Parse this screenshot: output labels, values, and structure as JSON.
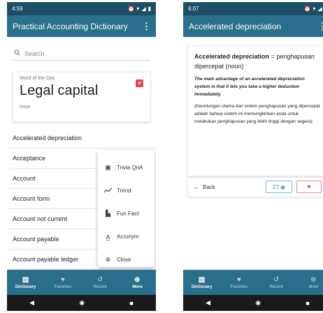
{
  "left": {
    "status": {
      "time": "4:59",
      "icons": [
        "notification-icon",
        "alarm-icon",
        "wifi-icon",
        "signal-icon",
        "battery-icon"
      ]
    },
    "appbar": {
      "title": "Practical Accounting Dictionary"
    },
    "search": {
      "placeholder": "Search"
    },
    "word_of_day": {
      "caption": "Word of the Day",
      "term": "Legal capital",
      "part_of_speech": "noun"
    },
    "words": [
      "Accelerated depreciation",
      "Acceptance",
      "Account",
      "Account form",
      "Account not current",
      "Account payable",
      "Account payable ledger"
    ],
    "more_menu": [
      {
        "label": "Trivia QnA",
        "icon": "trivia-icon"
      },
      {
        "label": "Trend",
        "icon": "trend-icon"
      },
      {
        "label": "Fun Fact",
        "icon": "fun-fact-icon"
      },
      {
        "label": "Acronym",
        "icon": "acronym-icon"
      },
      {
        "label": "Close",
        "icon": "close-icon"
      }
    ]
  },
  "right": {
    "status": {
      "time": "6:07",
      "icons": [
        "whatsapp-icon",
        "notification-icon",
        "alarm-icon",
        "wifi-icon",
        "signal-icon",
        "battery-icon"
      ]
    },
    "appbar": {
      "title": "Accelerated depreciation"
    },
    "definition": {
      "term": "Accelerated depreciation",
      "translation": "= penghapusan dipercepat (noun)",
      "example_en": "The main advantage of an accelerated depreciation system is that it lets you take a higher deduction immediately",
      "example_id": "(Keuntungan utama dari sistem penghapusan yang dipercepat adalah bahwa sistem ini memungkinkan anda untuk melakukan penghapusan yang lebih tinggi dengan segera)"
    },
    "actions": {
      "back_label": "Back",
      "views": "27"
    }
  },
  "bottom_nav": [
    {
      "label": "Dictionary",
      "icon": "book-icon"
    },
    {
      "label": "Favorites",
      "icon": "heart-icon"
    },
    {
      "label": "Recent",
      "icon": "history-icon"
    },
    {
      "label": "More",
      "icon": "plus-icon"
    }
  ],
  "colors": {
    "appbar": "#2a6f8c",
    "statusbar": "#1c4f66",
    "accent_red": "#d94a4a",
    "views_blue": "#3b8fbe"
  }
}
